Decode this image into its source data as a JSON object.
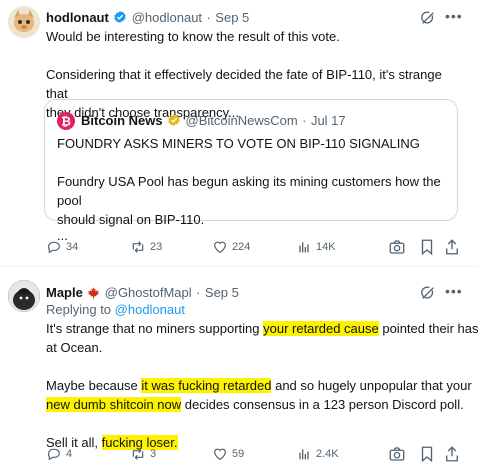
{
  "tweet1": {
    "author_name": "hodlonaut",
    "handle": "@hodlonaut",
    "sep": "·",
    "time": "Sep 5",
    "line1": "Would be interesting to know the result of this vote.",
    "line2a": "Considering that it effectively decided the fate of BIP-110, it's strange that",
    "line2b": "they didn't choose transparency...",
    "quote": {
      "author_name": "Bitcoin News",
      "handle": "@BitcoinNewsCom",
      "sep": "·",
      "time": "Jul 17",
      "headline": "FOUNDRY ASKS MINERS TO VOTE ON BIP-110 SIGNALING",
      "body1": "Foundry USA Pool has begun asking its mining customers how the pool",
      "body2": "should signal on BIP-110.",
      "ellipsis": "..."
    },
    "actions": {
      "replies": "34",
      "reposts": "23",
      "likes": "224",
      "views": "14K"
    }
  },
  "tweet2": {
    "author_name": "Maple",
    "handle": "@GhostofMapl",
    "sep": "·",
    "time": "Sep 5",
    "replying_to": "Replying to",
    "replying_handle": "@hodlonaut",
    "p1_a": "It's strange that no miners supporting ",
    "p1_hl": "your retarded cause",
    "p1_b": " pointed their hash",
    "p1_c": "at Ocean.",
    "p2_a": "Maybe because ",
    "p2_hl1": "it was fucking retarded",
    "p2_b": " and so hugely unpopular that your",
    "p2_hl2": "new dumb shitcoin now",
    "p2_c": " decides consensus in a 123 person Discord poll.",
    "p3_a": "Sell it all, ",
    "p3_hl": "fucking loser.",
    "actions": {
      "replies": "4",
      "reposts": "3",
      "likes": "59",
      "views": "2.4K"
    }
  },
  "colors": {
    "accent": "#1d9bf0",
    "highlight": "#fff200",
    "muted": "#536471",
    "gold": "#e2b719",
    "bitcoin": "#e0245e"
  },
  "icons": [
    "grok-icon",
    "more-icon",
    "reply-icon",
    "repost-icon",
    "like-icon",
    "views-icon",
    "bookmark-icon",
    "share-icon",
    "verified-icon",
    "maple-leaf-icon",
    "bitcoin-logo-icon"
  ]
}
